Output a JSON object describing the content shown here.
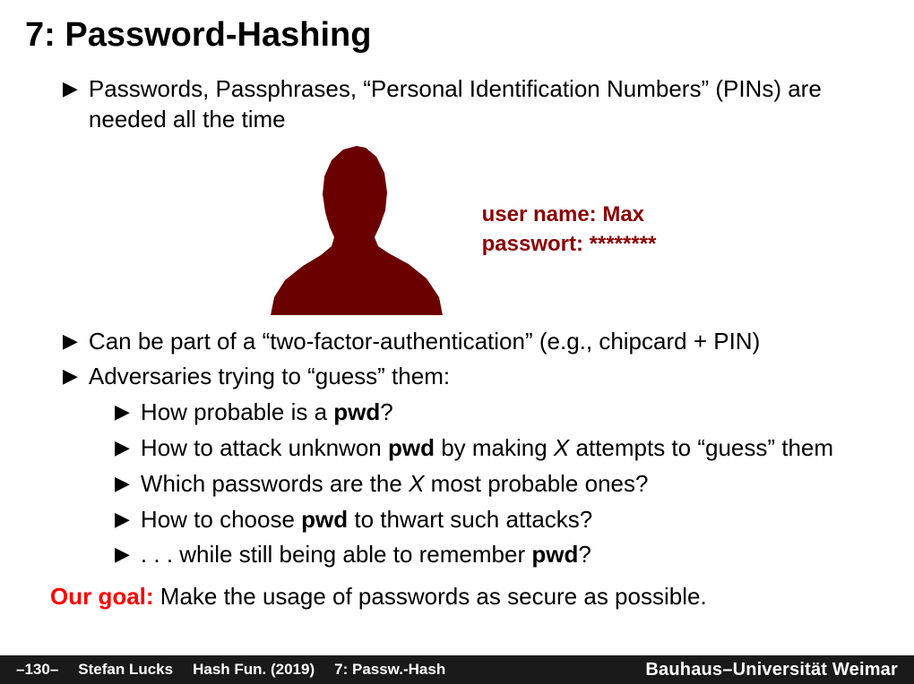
{
  "title": "7: Password-Hashing",
  "bullets": {
    "b1": "Passwords, Passphrases, “Personal Identification Numbers” (PINs) are needed all the time",
    "b2": "Can be part of a “two-factor-authentication” (e.g., chipcard + PIN)",
    "b3": "Adversaries trying to “guess” them:",
    "s1_pre": "How probable is a ",
    "s1_bold": "pwd",
    "s1_post": "?",
    "s2_pre": "How to attack unknwon ",
    "s2_bold": "pwd",
    "s2_mid": " by making ",
    "s2_x": "X",
    "s2_post": " attempts to “guess” them",
    "s3_pre": "Which passwords are the ",
    "s3_x": "X",
    "s3_post": " most probable ones?",
    "s4_pre": "How to choose ",
    "s4_bold": "pwd",
    "s4_post": " to thwart such attacks?",
    "s5_pre": ". . .  while still being able to remember ",
    "s5_bold": "pwd",
    "s5_post": "?"
  },
  "login": {
    "line1": "user name: Max",
    "line2": "passwort: ********"
  },
  "goal": {
    "label": "Our goal:",
    "text": " Make the usage of passwords as secure as possible."
  },
  "footer": {
    "page": "–130–",
    "author": "Stefan Lucks",
    "course": "Hash Fun. (2019)",
    "section": "7: Passw.-Hash",
    "uni": "Bauhaus–Universität Weimar"
  },
  "marker": "▶"
}
